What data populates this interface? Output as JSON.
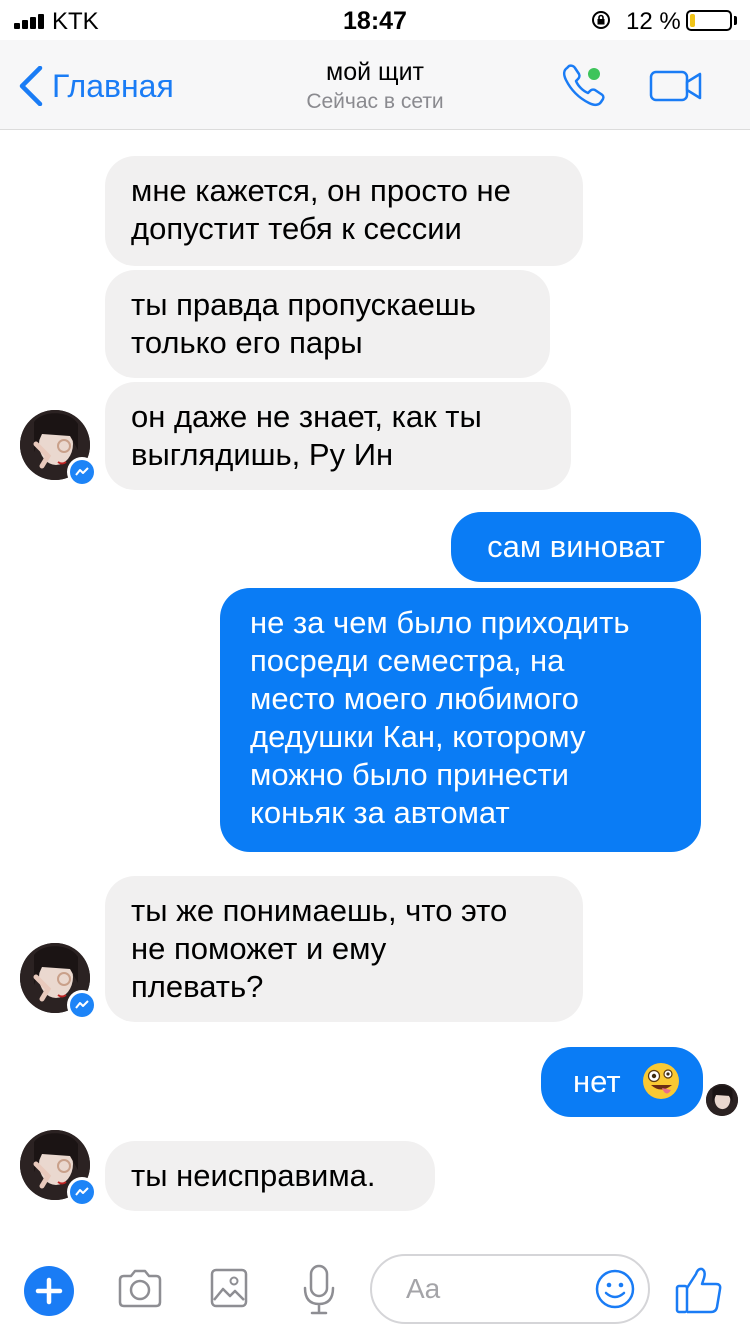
{
  "status_bar": {
    "carrier": "KTK",
    "time": "18:47",
    "battery_percent": "12 %",
    "battery_level": 0.12,
    "battery_color": "#f0c418"
  },
  "nav": {
    "back_label": "Главная",
    "title": "мой щит",
    "subtitle": "Сейчас в сети",
    "icons": [
      "chevron-left-icon",
      "phone-icon",
      "video-camera-icon"
    ],
    "accent": "#1a7cf5",
    "online_dot_color": "#3ec45b"
  },
  "messages": [
    {
      "side": "incoming",
      "lines": [
        "мне кажется, он просто не",
        "допустит тебя к сессии"
      ]
    },
    {
      "side": "incoming",
      "lines": [
        "ты правда пропускаешь",
        "только его пары"
      ]
    },
    {
      "side": "incoming",
      "lines": [
        "он даже не знает, как ты",
        "выглядишь, Ру Ин"
      ]
    },
    {
      "side": "outgoing",
      "lines": [
        "сам виноват"
      ]
    },
    {
      "side": "outgoing",
      "lines": [
        "не за чем было приходить",
        "посреди семестра, на",
        "место моего любимого",
        "дедушки Кан, которому",
        "можно было принести",
        "коньяк за автомат"
      ]
    },
    {
      "side": "incoming",
      "lines": [
        "ты же понимаешь, что это",
        "не поможет и ему",
        "плевать?"
      ]
    },
    {
      "side": "outgoing",
      "lines": [
        "нет"
      ],
      "emoji": "zany-face-emoji"
    },
    {
      "side": "incoming",
      "lines": [
        "ты неисправима."
      ]
    }
  ],
  "colors": {
    "incoming_bubble": "#f1f0f0",
    "outgoing_bubble": "#0a7cf5",
    "messenger_badge": "#1d84f7"
  },
  "composer": {
    "placeholder": "Aa",
    "icons": [
      "plus-icon",
      "camera-icon",
      "image-icon",
      "microphone-icon",
      "smiley-icon",
      "thumbs-up-icon"
    ]
  }
}
